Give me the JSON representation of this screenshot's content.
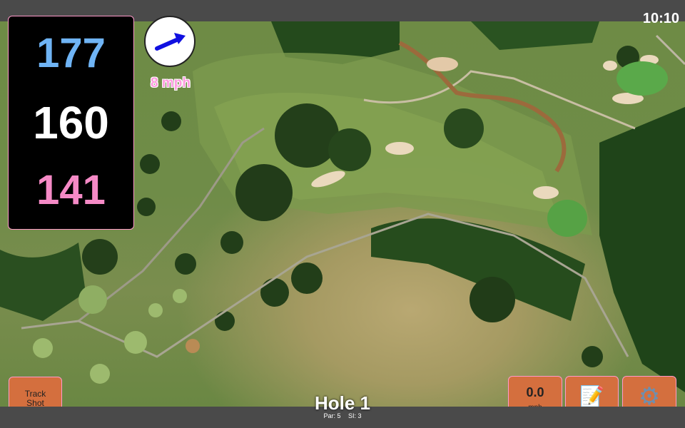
{
  "status": {
    "time": "10:10"
  },
  "yardages": {
    "back": "177",
    "middle": "160",
    "front": "141"
  },
  "wind": {
    "speed": "8 mph",
    "icon": "wind-arrow-icon"
  },
  "track_button": {
    "label_line1": "Track",
    "label_line2": "Shot"
  },
  "speed_button": {
    "value": "0.0",
    "unit": "mph"
  },
  "notes_button": {
    "icon": "notepad-icon",
    "glyph": "📝"
  },
  "settings_button": {
    "icon": "gear-icon",
    "glyph": "⚙"
  },
  "hole": {
    "title": "Hole 1",
    "par": "Par: 5",
    "si": "SI: 3"
  },
  "colors": {
    "accent_button": "#d46f3e",
    "border": "#ff9acb",
    "back_yardage": "#6fb4f5",
    "front_yardage": "#f58ac6"
  }
}
